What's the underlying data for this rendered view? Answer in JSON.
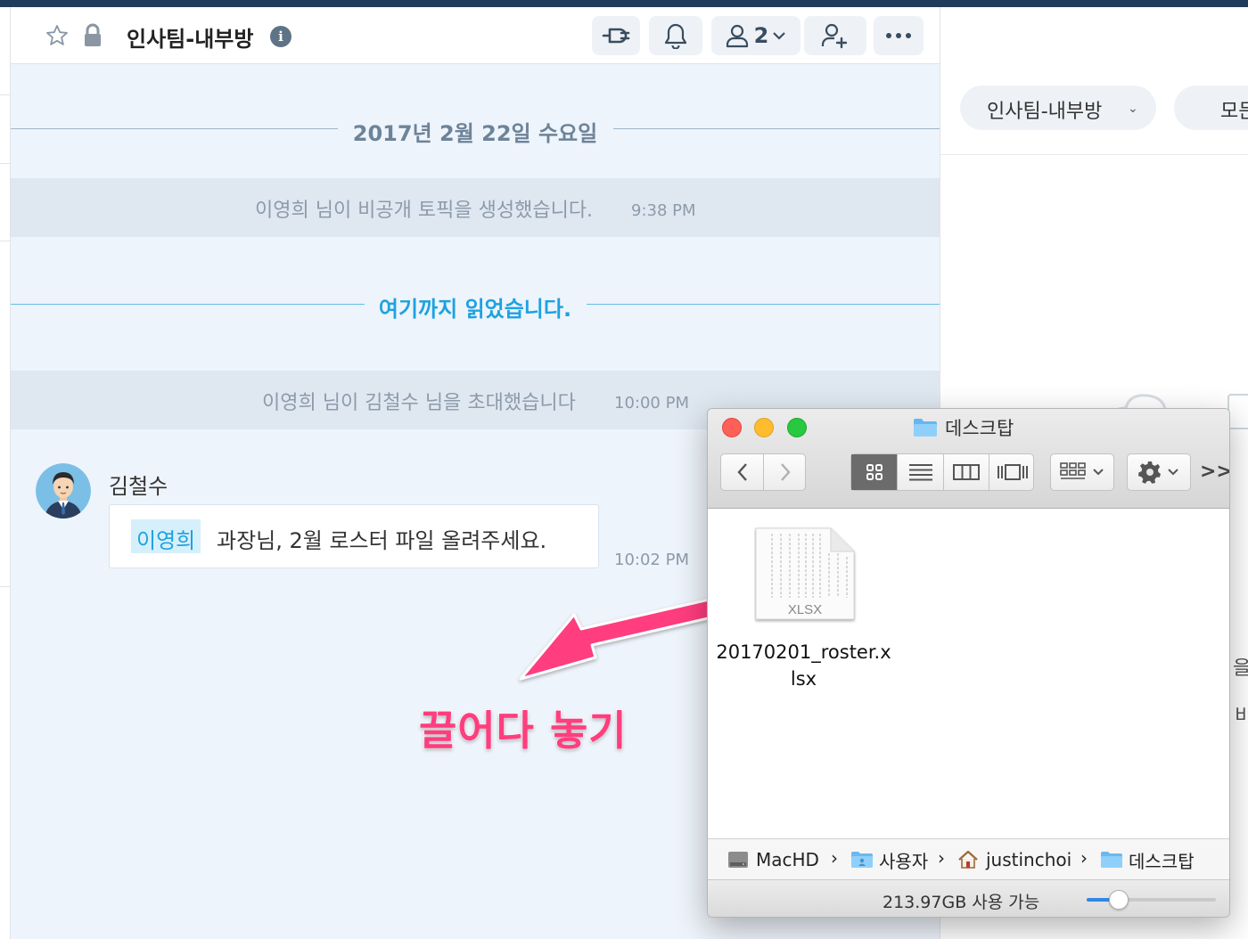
{
  "header": {
    "title": "인사팀-내부방",
    "info_label": "i",
    "member_count": "2"
  },
  "messages": {
    "date_divider": "2017년 2월 22일 수요일",
    "system_1": {
      "text": "이영희 님이 비공개 토픽을 생성했습니다.",
      "time": "9:38 PM"
    },
    "read_marker": "여기까지 읽었습니다.",
    "system_2": {
      "text": "이영희 님이 김철수 님을 초대했습니다",
      "time": "10:00 PM"
    },
    "chat": {
      "sender": "김철수",
      "mention": "이영희",
      "text": "과장님, 2월 로스터 파일 올려주세요.",
      "time": "10:02 PM"
    }
  },
  "annotation": {
    "label": "끌어다 놓기",
    "color": "#ff3d7f"
  },
  "right_panel": {
    "dropdown_1": "인사팀-내부방",
    "dropdown_2": "모든",
    "fragments": [
      "을",
      "비"
    ]
  },
  "finder": {
    "title": "데스크탑",
    "file": {
      "type_label": "XLSX",
      "name_line1": "20170201_roster.x",
      "name_line2": "lsx"
    },
    "path": [
      "MacHD",
      "사용자",
      "justinchoi",
      "데스크탑"
    ],
    "path_separator": "›",
    "more_label": ">>",
    "status": "213.97GB 사용 가능",
    "icon_zoom_level": 0.25
  },
  "colors": {
    "accent": "#1ea2e0",
    "traffic_close": "#fe5f57",
    "traffic_minimize": "#febc2e",
    "traffic_zoom": "#28c840"
  }
}
